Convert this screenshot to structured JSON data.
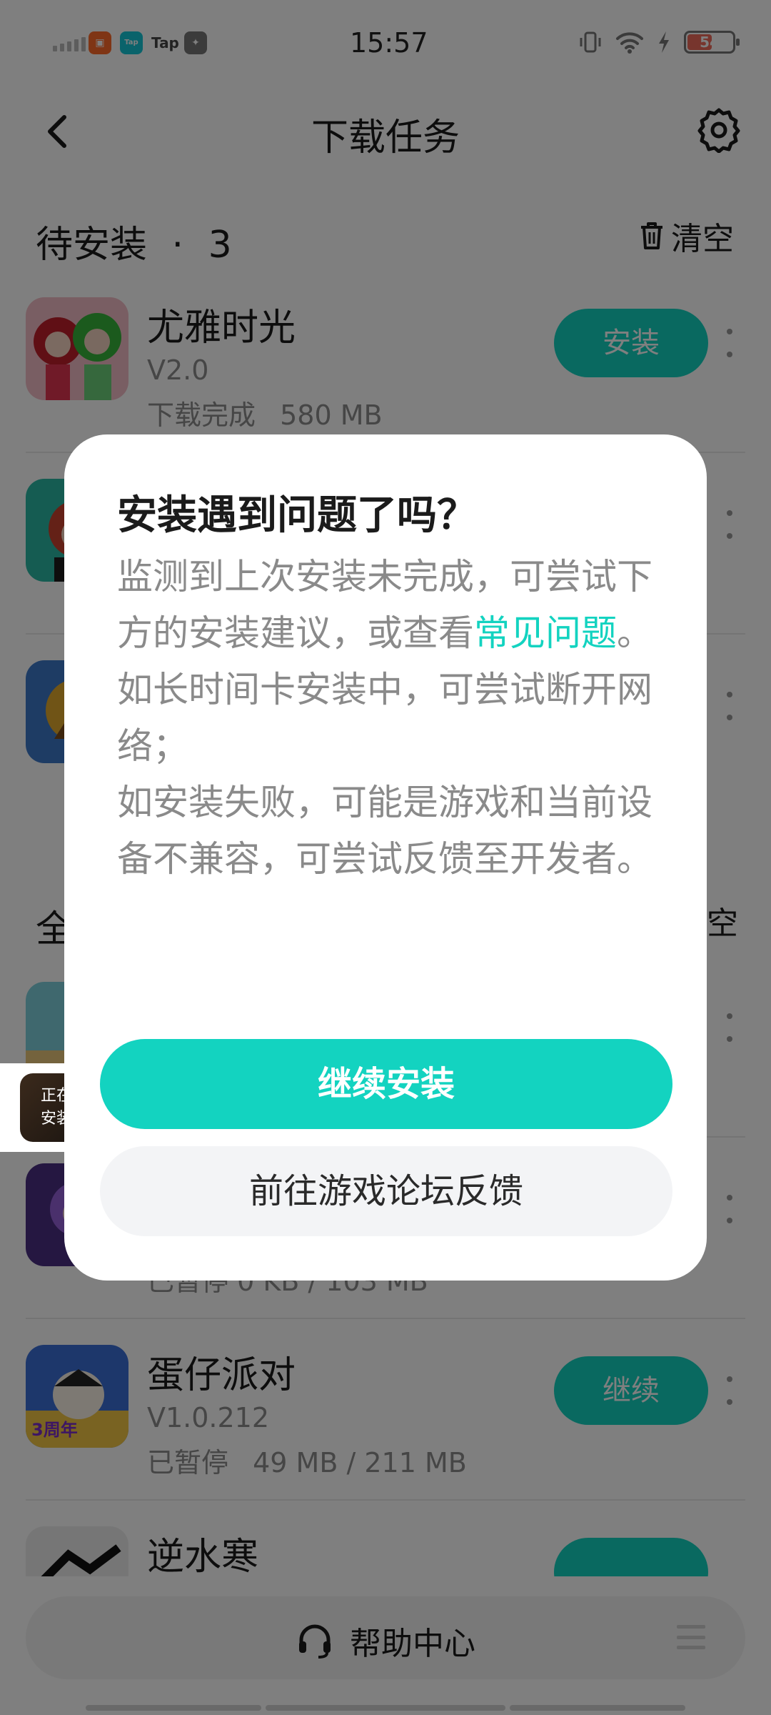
{
  "status_bar": {
    "time": "15:57",
    "tap_label": "Tap",
    "battery": "54"
  },
  "header": {
    "title": "下载任务"
  },
  "pending": {
    "title": "待安装",
    "dot": "·",
    "count": "3",
    "clear_label": "清空",
    "items": [
      {
        "name": "尤雅时光",
        "version": "V2.0",
        "status": "下载完成",
        "size": "580 MB",
        "button": "安装"
      }
    ]
  },
  "all_section": {
    "title_partial": "全",
    "clear_partial": "空"
  },
  "downloads": {
    "items": [
      {
        "status_partial": "已暂停 0 KB / 103 MB"
      },
      {
        "name": "蛋仔派对",
        "version": "V1.0.212",
        "status": "已暂停",
        "size": "49 MB / 211 MB",
        "button": "继续",
        "icon_badge": "3周年"
      },
      {
        "name": "逆水寒"
      }
    ]
  },
  "floater": {
    "label_line1": "正在",
    "label_line2": "安装"
  },
  "help": {
    "label": "帮助中心"
  },
  "dialog": {
    "title": "安装遇到问题了吗？",
    "body_part1": "监测到上次安装未完成，可尝试下方的安装建议，或查看",
    "link": "常见问题",
    "body_part2": "。",
    "line2": "如长时间卡安装中，可尝试断开网络；",
    "line3": "如安装失败，可能是游戏和当前设备不兼容，可尝试反馈至开发者。",
    "primary_button": "继续安装",
    "secondary_button": "前往游戏论坛反馈"
  },
  "colors": {
    "accent": "#13d3c0",
    "overlay": "rgba(0,0,0,0.5)"
  }
}
